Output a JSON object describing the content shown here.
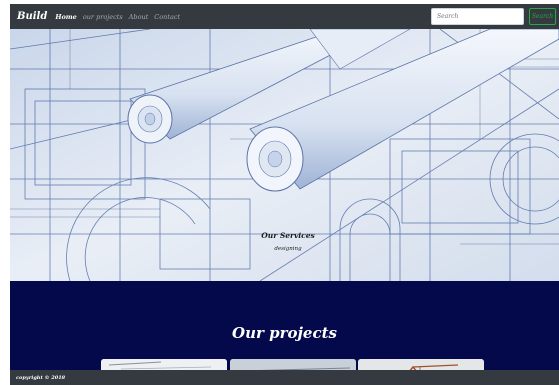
{
  "navbar": {
    "brand": "Build",
    "links": [
      {
        "label": "Home",
        "active": true
      },
      {
        "label": "our projects",
        "active": false
      },
      {
        "label": "About",
        "active": false
      },
      {
        "label": "Contact",
        "active": false
      }
    ],
    "search": {
      "placeholder": "Search",
      "button_label": "Search"
    }
  },
  "hero": {
    "image": "architectural-blueprints-photo",
    "caption_title": "Our Services",
    "caption_subtitle": "designing"
  },
  "projects": {
    "title": "Our projects",
    "cards": [
      {
        "image": "construction-project-photo"
      },
      {
        "image": "construction-project-photo"
      },
      {
        "image": "construction-project-photo"
      }
    ]
  },
  "footer": {
    "copyright": "copyright © 2018"
  },
  "colors": {
    "navbar_bg": "#343a40",
    "projects_bg": "#03094a",
    "search_button": "#28a745",
    "blueprint_lines": "#3b5a9a"
  }
}
